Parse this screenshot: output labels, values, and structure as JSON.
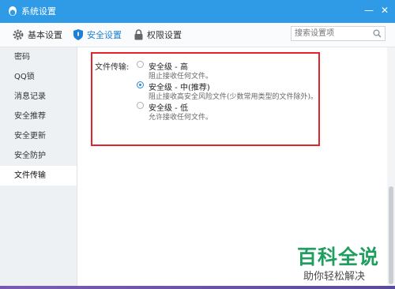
{
  "window": {
    "title": "系统设置"
  },
  "toolbar": {
    "tabs": [
      {
        "label": "基本设置",
        "icon": "gear-icon"
      },
      {
        "label": "安全设置",
        "icon": "shield-icon",
        "active": true
      },
      {
        "label": "权限设置",
        "icon": "lock-icon"
      }
    ],
    "search_placeholder": "搜索设置项"
  },
  "sidebar": {
    "items": [
      {
        "label": "密码"
      },
      {
        "label": "QQ锁"
      },
      {
        "label": "消息记录"
      },
      {
        "label": "安全推荐"
      },
      {
        "label": "安全更新"
      },
      {
        "label": "安全防护"
      },
      {
        "label": "文件传输",
        "active": true
      }
    ]
  },
  "file_transfer": {
    "label": "文件传输:",
    "options": [
      {
        "title": "安全级 - 高",
        "desc": "阻止接收任何文件。",
        "checked": false
      },
      {
        "title": "安全级 - 中(推荐)",
        "desc": "阻止接收高安全风险文件(少数常用类型的文件除外)。",
        "checked": true
      },
      {
        "title": "安全级 - 低",
        "desc": "允许接收任何文件。",
        "checked": false
      }
    ]
  },
  "colors": {
    "titlebar": "#2f9be6",
    "accent": "#1e7fd6",
    "highlight_border": "#e0242b",
    "watermark": "#1f9e5f"
  },
  "watermark": {
    "title": "百科全说",
    "subtitle": "助你轻松解决"
  }
}
